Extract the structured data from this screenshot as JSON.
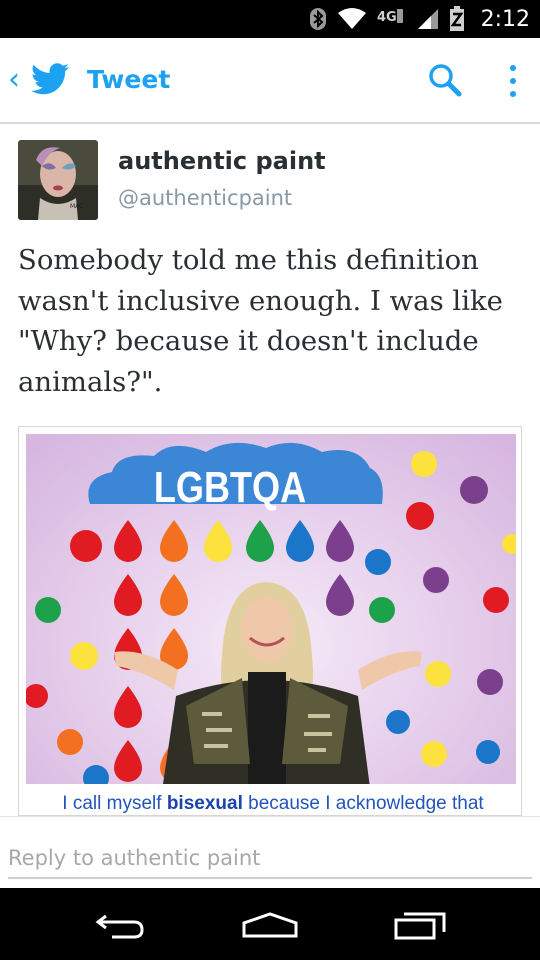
{
  "status_bar": {
    "time": "2:12",
    "network_label": "4G",
    "icons": [
      "bluetooth-icon",
      "wifi-icon",
      "signal-icon",
      "battery-icon"
    ]
  },
  "action_bar": {
    "back_glyph": "‹",
    "title": "Tweet",
    "icons": [
      "twitter-bird-icon",
      "search-icon",
      "overflow-menu-icon"
    ]
  },
  "tweet": {
    "author_name": "authentic paint",
    "handle": "@authenticpaint",
    "text": "Somebody told me this definition wasn't inclusive enough. I was like \"Why? because it doesn't include animals?\"."
  },
  "photo": {
    "banner_text": "LGBTQA",
    "caption_pre": "I call myself ",
    "caption_bold": "bisexual",
    "caption_post": " because I acknowledge that"
  },
  "reply": {
    "placeholder": "Reply to authentic paint"
  },
  "nav": {
    "icons": [
      "back-icon",
      "home-icon",
      "recents-icon"
    ]
  },
  "colors": {
    "twitter_blue": "#1da1f2",
    "status_bar": "#000000",
    "text_dark": "#292f33",
    "text_muted": "#8899a6"
  }
}
